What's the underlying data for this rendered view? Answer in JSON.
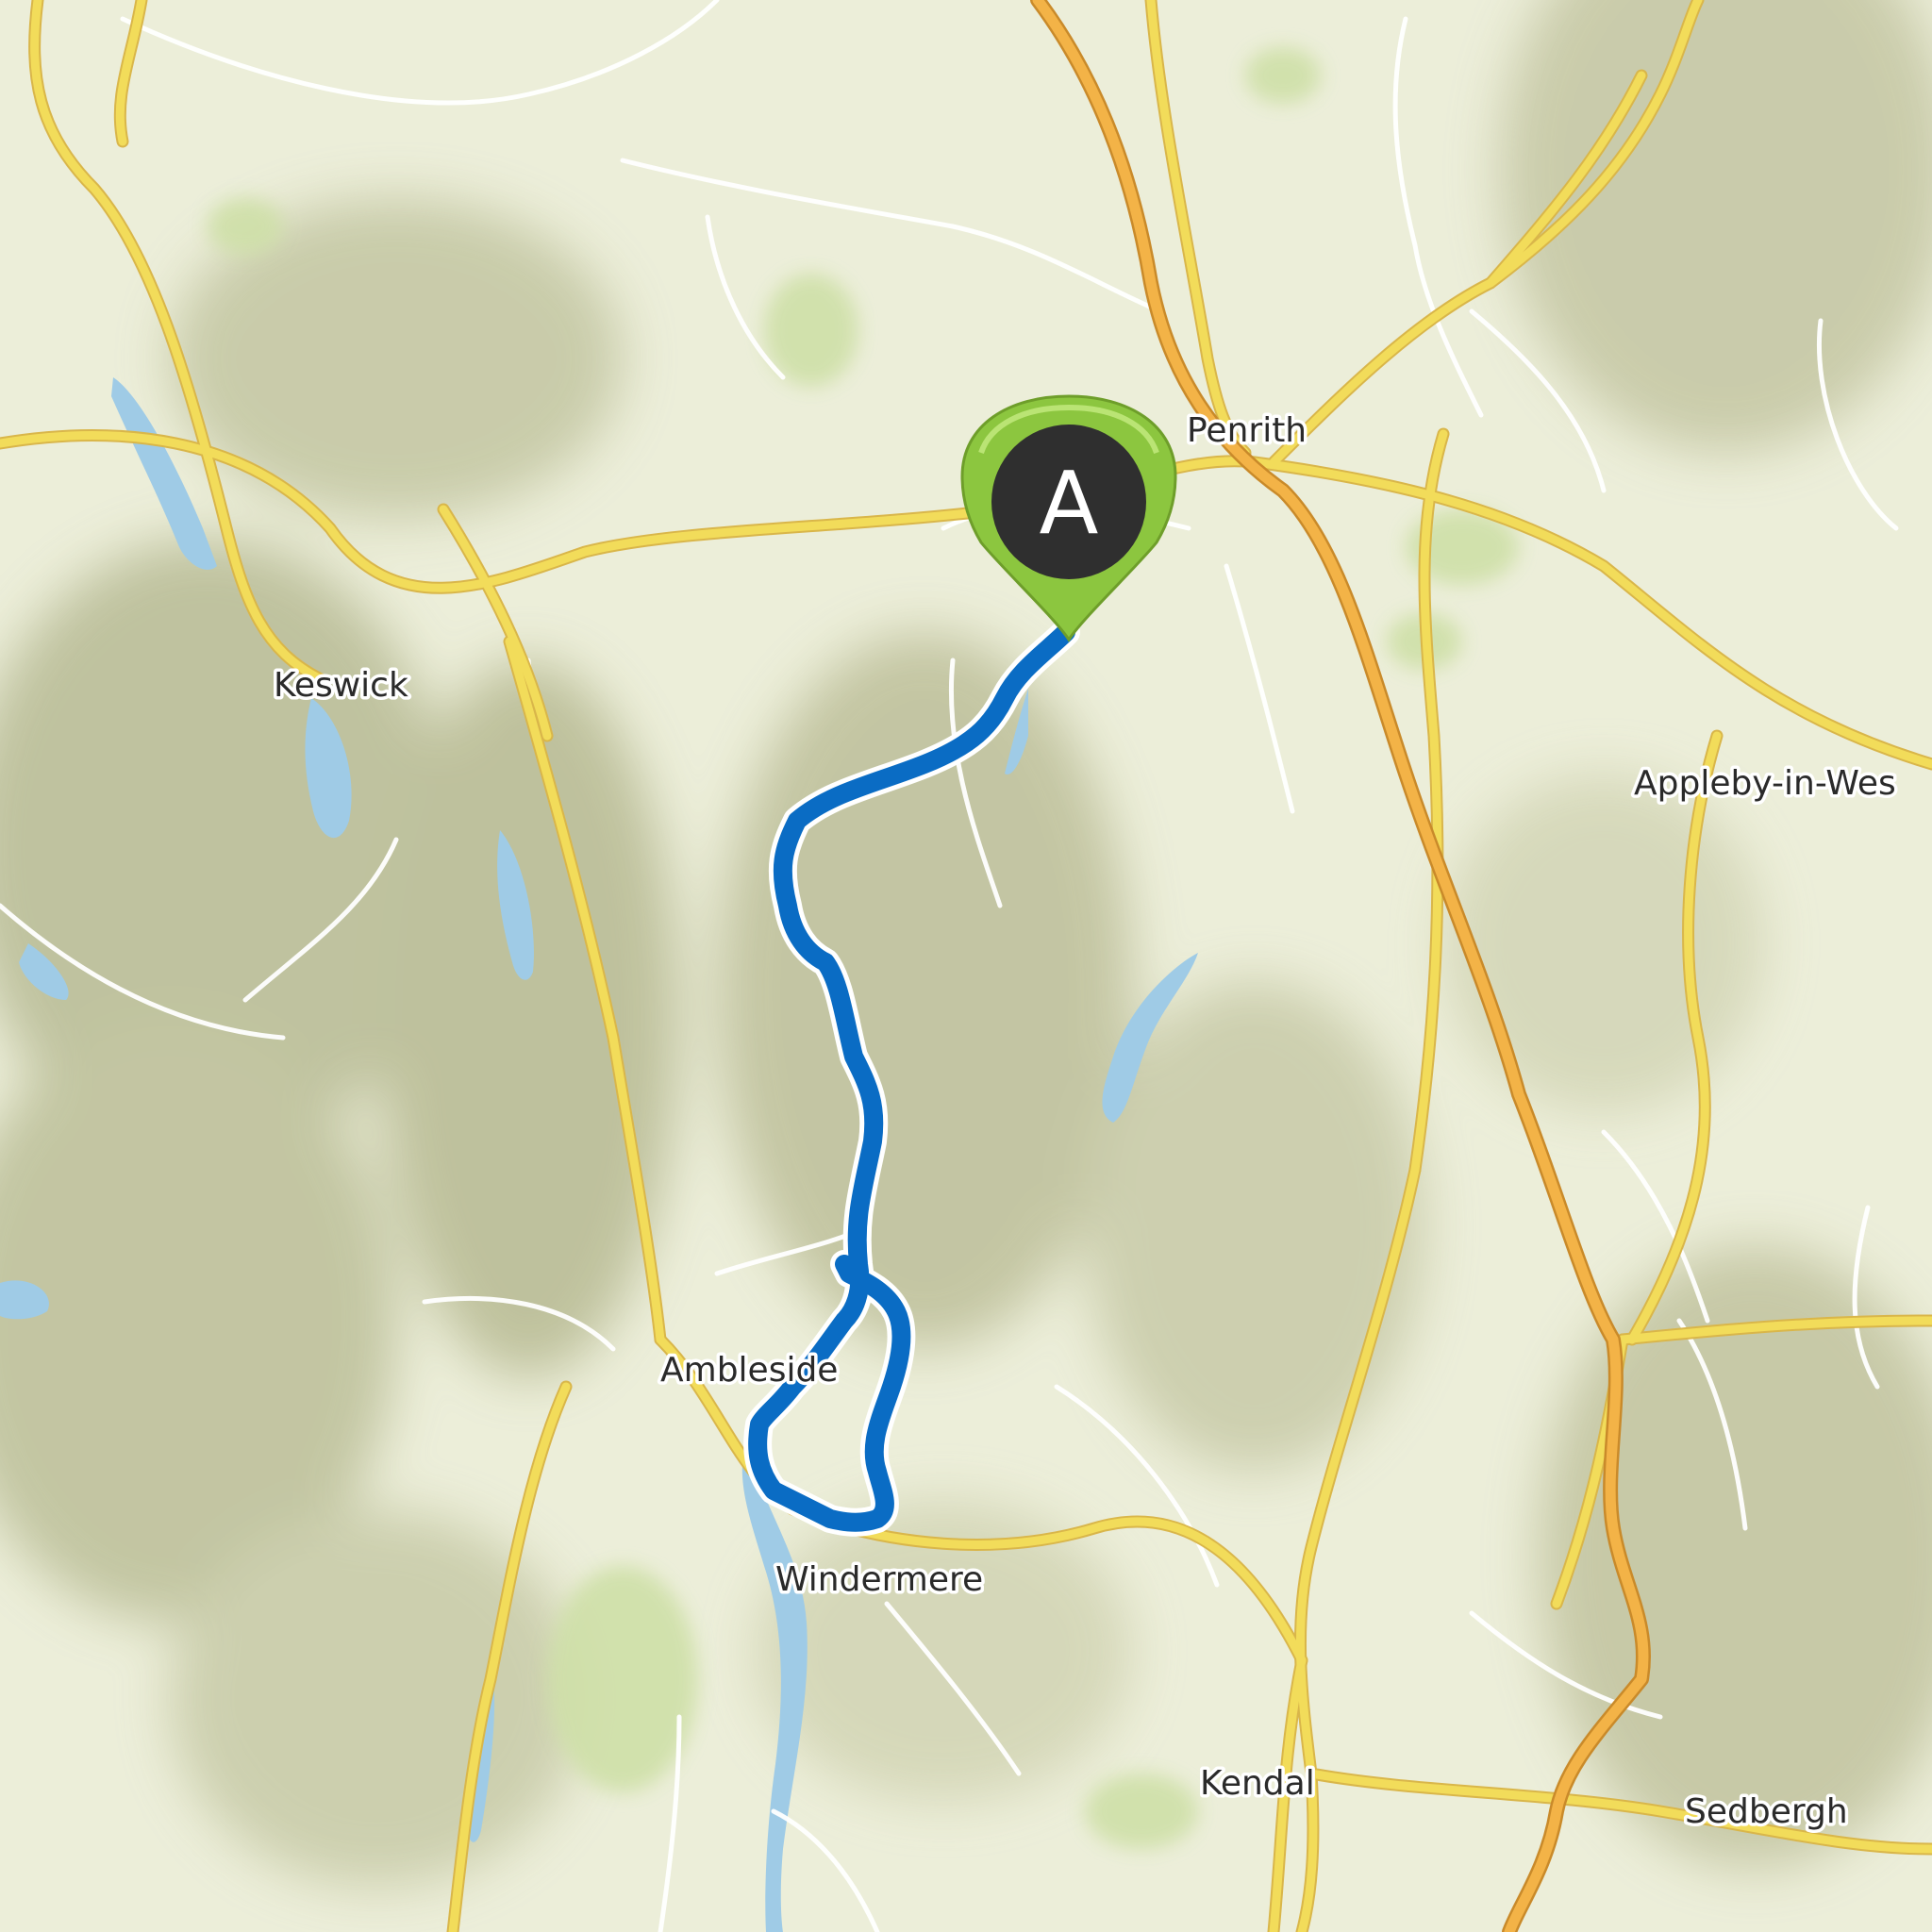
{
  "map": {
    "places": [
      {
        "id": "penrith",
        "name": "Penrith"
      },
      {
        "id": "keswick",
        "name": "Keswick"
      },
      {
        "id": "appleby",
        "name": "Appleby-in-Wes"
      },
      {
        "id": "ambleside",
        "name": "Ambleside"
      },
      {
        "id": "windermere",
        "name": "Windermere"
      },
      {
        "id": "kendal",
        "name": "Kendal"
      },
      {
        "id": "sedbergh",
        "name": "Sedbergh"
      }
    ],
    "start_marker": {
      "label": "A",
      "color": "#8cc63f",
      "body_color": "#2f2f2f"
    },
    "route": {
      "color": "#0a6cc4",
      "casing_color": "#ffffff"
    },
    "colors": {
      "land": "#eceed9",
      "hills": "#b9bc96",
      "woodland": "#cfe0a8",
      "water": "#9fcbe6",
      "major_road": "#f2dc5a",
      "motorway": "#f3b347",
      "minor_road": "#ffffff"
    }
  }
}
